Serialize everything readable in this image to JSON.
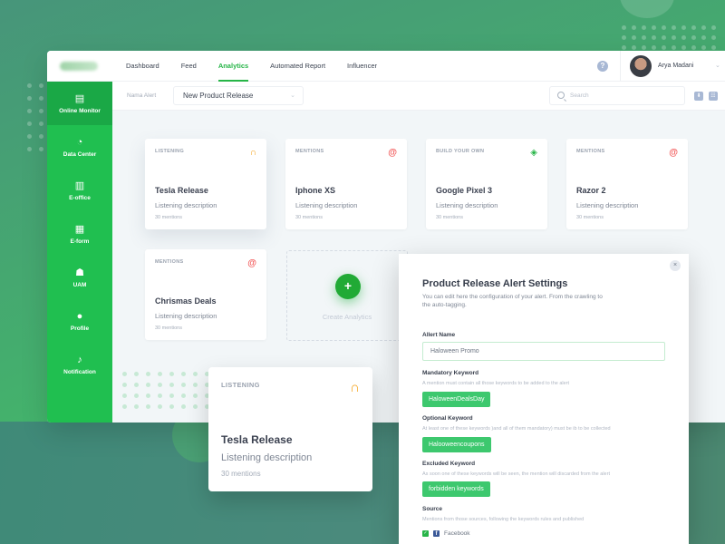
{
  "app": {
    "nav": [
      {
        "label": "Dashboard",
        "active": false
      },
      {
        "label": "Feed",
        "active": false
      },
      {
        "label": "Analytics",
        "active": true
      },
      {
        "label": "Automated Report",
        "active": false
      },
      {
        "label": "Influencer",
        "active": false
      }
    ],
    "help_icon": "?",
    "user": {
      "name": "Arya Madani",
      "chevron": "⌄"
    }
  },
  "sidebar": {
    "items": [
      {
        "label": "Online Monitor",
        "icon": "monitor-icon",
        "glyph": "▤",
        "active": true
      },
      {
        "label": "Data Center",
        "icon": "pie-chart-icon",
        "glyph": "◔",
        "active": false
      },
      {
        "label": "E-office",
        "icon": "building-icon",
        "glyph": "▥",
        "active": false
      },
      {
        "label": "E-form",
        "icon": "document-icon",
        "glyph": "▦",
        "active": false
      },
      {
        "label": "UAM",
        "icon": "users-icon",
        "glyph": "☗",
        "active": false
      },
      {
        "label": "Profile",
        "icon": "user-icon",
        "glyph": "●",
        "active": false
      },
      {
        "label": "Notification",
        "icon": "bell-icon",
        "glyph": "♪",
        "active": false
      }
    ]
  },
  "subbar": {
    "alert_label": "Nama Alert",
    "alert_value": "New Product Release",
    "search_placeholder": "Search"
  },
  "cards": [
    {
      "type": "LISTENING",
      "icon": "headphones-icon",
      "glyph": "🎧",
      "title": "Tesla Release",
      "description": "Listening description",
      "count": "30 mentions"
    },
    {
      "type": "MENTIONS",
      "icon": "at-icon",
      "glyph": "@",
      "title": "Iphone XS",
      "description": "Listening description",
      "count": "30 mentions"
    },
    {
      "type": "BUILD YOUR OWN",
      "icon": "layers-icon",
      "glyph": "◈",
      "title": "Google Pixel 3",
      "description": "Listening description",
      "count": "30 mentions"
    },
    {
      "type": "MENTIONS",
      "icon": "at-icon",
      "glyph": "@",
      "title": "Razor 2",
      "description": "Listening description",
      "count": "30 mentions"
    },
    {
      "type": "MENTIONS",
      "icon": "at-icon",
      "glyph": "@",
      "title": "Chrismas Deals",
      "description": "Listening description",
      "count": "30 mentions"
    }
  ],
  "create": {
    "button": "+",
    "label": "Create Analytics"
  },
  "floating_card": {
    "type": "LISTENING",
    "glyph": "🎧",
    "title": "Tesla Release",
    "description": "Listening description",
    "count": "30 mentions"
  },
  "modal": {
    "close": "×",
    "title": "Product Release Alert Settings",
    "subtitle": "You can edit here the configuration of your alert. From the crawling to the auto-tagging.",
    "alert_name_label": "Allert Name",
    "alert_name_value": "Haloween Promo",
    "mandatory": {
      "label": "Mandatory Keyword",
      "help": "A mention must contain all those keywords to be added to the alert",
      "tag": "HaloweenDealsDay"
    },
    "optional": {
      "label": "Optional Keyword",
      "help": "At least one of these keywords )and all of them mandatory) must be ib to be collected",
      "tag": "Halooweencoupons"
    },
    "excluded": {
      "label": "Excluded Keyword",
      "help": "As soon one of these keywords will be seen, the mention will discarded from the alert",
      "tag": "forbidden keywords"
    },
    "source": {
      "label": "Source",
      "help": "Mentions from those sources, following the keywords rules and published",
      "items": [
        {
          "label": "Facebook",
          "checked": true
        }
      ]
    }
  },
  "colors": {
    "accent": "#27b548",
    "sidebar": "#20bf50",
    "tag": "#3dc86e",
    "listening_icon": "#f5a623",
    "mentions_icon": "#f25a5a",
    "build_icon": "#27b548"
  }
}
